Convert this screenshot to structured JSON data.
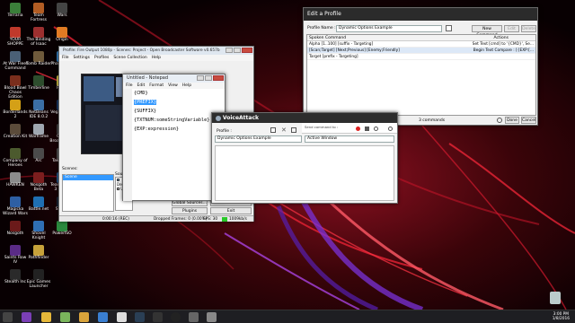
{
  "desktop": {
    "icons": [
      {
        "label": "Terraria",
        "color": "#3b7f3a"
      },
      {
        "label": "YOUR SHOPPE",
        "color": "#c0392b"
      },
      {
        "label": "At War Fleet Command",
        "color": "#4a6076"
      },
      {
        "label": "Blood Bowl Chaos Edition",
        "color": "#7a2e1c"
      },
      {
        "label": "Borderlands 2",
        "color": "#d4a017"
      },
      {
        "label": "Creation Kit",
        "color": "#5b4b3a"
      },
      {
        "label": "Company of Heroes",
        "color": "#4c5a2e"
      },
      {
        "label": "HAWKEN",
        "color": "#8c8c8c"
      },
      {
        "label": "Magicka Wizard Wars",
        "color": "#2e5fa3"
      },
      {
        "label": "Nosgoth",
        "color": "#6b1a1a"
      },
      {
        "label": "Saints Row IV",
        "color": "#5a2b86"
      },
      {
        "label": "Stealth Inc",
        "color": "#2a2a2a"
      },
      {
        "label": "Team Fortress",
        "color": "#b35d24"
      },
      {
        "label": "The Binding of Isaac",
        "color": "#9c2f2f"
      },
      {
        "label": "Tomb Raider",
        "color": "#6f5a3b"
      },
      {
        "label": "Timberline",
        "color": "#2d4d2d"
      },
      {
        "label": "NetBeans IDE 8.0.2",
        "color": "#3b6ea5"
      },
      {
        "label": "Warframe",
        "color": "#9fa7b0"
      },
      {
        "label": "Arc",
        "color": "#4b4b4b"
      },
      {
        "label": "Nosgoth Beta",
        "color": "#7c1e1e"
      },
      {
        "label": "Battle.net",
        "color": "#1f6fb2"
      },
      {
        "label": "Shovel Knight",
        "color": "#2f6fb5"
      },
      {
        "label": "Pathfinder",
        "color": "#c7a23a"
      },
      {
        "label": "Epic Games Launcher",
        "color": "#222"
      },
      {
        "label": "Wars",
        "color": "#444"
      },
      {
        "label": "Origin",
        "color": "#e27b23"
      },
      {
        "label": "Phase Shift",
        "color": "#3a86c9"
      },
      {
        "label": "Fraps",
        "color": "#d8c84a"
      },
      {
        "label": "Vega Strike",
        "color": "#1c3b6b"
      },
      {
        "label": "Open Broadcaster",
        "color": "#444"
      },
      {
        "label": "Takedown",
        "color": "#555"
      },
      {
        "label": "TeamSpeak 3 Client",
        "color": "#2a5b8c"
      },
      {
        "label": "Steam",
        "color": "#1b2838"
      },
      {
        "label": "PowerISO",
        "color": "#2b8a3e"
      }
    ]
  },
  "obs": {
    "title": "Profile: Fire Output 1080p - Scenes: Project - Open Broadcaster Software v0.657b",
    "menu": [
      "File",
      "Settings",
      "Profiles",
      "Scene Collection",
      "Help"
    ],
    "scenes_label": "Scenes:",
    "scene_item": "Scene",
    "sources_label": "Sources:",
    "sources": [
      "Desktop",
      "Unity"
    ],
    "buttons": {
      "global_sources": "Global Sources...",
      "preview_stream": "Preview Stream",
      "plugins": "Plugins",
      "exit": "Exit"
    },
    "status": {
      "time": "0:00:16 (REC)",
      "dropped": "Dropped Frames: 0 (0.00%)",
      "fps": "FPS: 30",
      "bitrate": "1009kb/s"
    }
  },
  "notepad": {
    "title": "Untitled - Notepad",
    "menu": [
      "File",
      "Edit",
      "Format",
      "View",
      "Help"
    ],
    "lines": [
      "{CMD}",
      "{PREFIX}",
      "{SUFFIX}",
      "{TXTNUM:someStringVariable}",
      "{EXP:expression}"
    ]
  },
  "voiceattack": {
    "title": "VoiceAttack",
    "profile_label": "Profile :",
    "profile_value": "Dynamic Options Example",
    "listening_label": "Active Window",
    "send_label": "Send command to :"
  },
  "edit_profile": {
    "title": "Edit a Profile",
    "profile_name_label": "Profile Name :",
    "profile_name_value": "Dynamic Options Example",
    "buttons": {
      "new_command": "New Command",
      "edit": "Edit",
      "delete": "Delete",
      "import": "Import Commands",
      "done": "Done",
      "cancel": "Cancel"
    },
    "columns": [
      "Spoken Command",
      "",
      "Actions"
    ],
    "rows": [
      {
        "cmd": "Alpha [1..100] [suffix - Targeting]",
        "action": "Set Text [cmd] to '{CMD}', Se..."
      },
      {
        "cmd": "[Scan;Target] [Next;Previous] [Enemy;Friendly]",
        "action": "Begin Text Compare : [{EXP:[..."
      },
      {
        "cmd": "Target [prefix - Targeting]",
        "action": ""
      }
    ],
    "count": "3 commands"
  },
  "clock": {
    "time": "3:00 PM",
    "date": "1/8/2016"
  }
}
